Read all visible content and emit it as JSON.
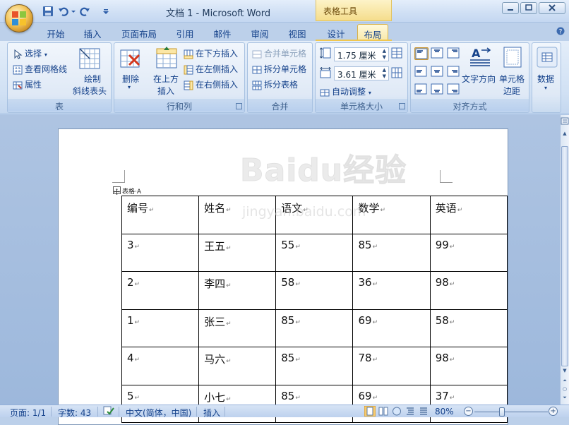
{
  "window": {
    "title": "文档 1 - Microsoft Word",
    "context_tab_title": "表格工具"
  },
  "tabs": [
    {
      "label": "开始"
    },
    {
      "label": "插入"
    },
    {
      "label": "页面布局"
    },
    {
      "label": "引用"
    },
    {
      "label": "邮件"
    },
    {
      "label": "审阅"
    },
    {
      "label": "视图"
    },
    {
      "label": "设计"
    },
    {
      "label": "布局",
      "active": true
    }
  ],
  "ribbon": {
    "table_group": {
      "label": "表",
      "select": "选择",
      "view_gridlines": "查看网格线",
      "properties": "属性",
      "draw_diagonal_1": "绘制",
      "draw_diagonal_2": "斜线表头"
    },
    "rows_cols_group": {
      "label": "行和列",
      "delete": "删除",
      "insert_above_1": "在上方",
      "insert_above_2": "插入",
      "insert_below": "在下方插入",
      "insert_left": "在左侧插入",
      "insert_right": "在右侧插入"
    },
    "merge_group": {
      "label": "合并",
      "merge_cells": "合并单元格",
      "split_cells": "拆分单元格",
      "split_table": "拆分表格"
    },
    "cell_size_group": {
      "label": "单元格大小",
      "height_value": "1.75 厘米",
      "width_value": "3.61 厘米",
      "autofit": "自动调整"
    },
    "align_group": {
      "label": "对齐方式",
      "text_direction": "文字方向",
      "cell_margins_1": "单元格",
      "cell_margins_2": "边距"
    },
    "data_group": {
      "label": "数据"
    }
  },
  "document": {
    "table_caption": "表格·A",
    "table_rows": [
      [
        "编号",
        "姓名",
        "语文",
        "数学",
        "英语"
      ],
      [
        "3",
        "王五",
        "55",
        "85",
        "99"
      ],
      [
        "2",
        "李四",
        "58",
        "36",
        "98"
      ],
      [
        "1",
        "张三",
        "85",
        "69",
        "58"
      ],
      [
        "4",
        "马六",
        "85",
        "78",
        "98"
      ],
      [
        "5",
        "小七",
        "85",
        "69",
        "37"
      ]
    ],
    "watermark_text": "Baidu经验",
    "watermark_url": "jingyan.baidu.com"
  },
  "statusbar": {
    "page": "页面: 1/1",
    "words": "字数: 43",
    "language": "中文(简体，中国)",
    "mode": "插入",
    "zoom": "80%"
  },
  "colors": {
    "ribbon_text": "#15428b",
    "context_tab": "#f5dd8c",
    "selected_align": "#f8c96a"
  }
}
